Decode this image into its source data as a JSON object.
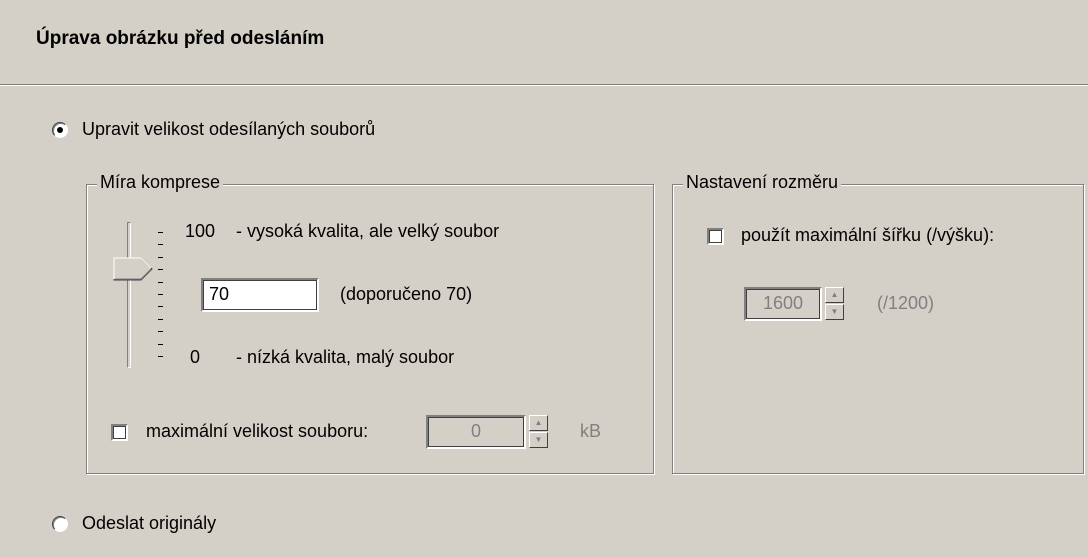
{
  "header": {
    "title": "Úprava obrázku před odesláním"
  },
  "options": {
    "resize_label": "Upravit velikost odesílaných souborů",
    "original_label": "Odeslat originály"
  },
  "compression": {
    "legend": "Míra komprese",
    "max_value": "100",
    "max_desc": "- vysoká kvalita, ale velký soubor",
    "current_value": "70",
    "recommended": "(doporučeno 70)",
    "min_value": "0",
    "min_desc": "- nízká kvalita, malý soubor",
    "slider_level": 70,
    "max_size_label": "maximální velikost souboru:",
    "max_size_value": "0",
    "max_size_unit": "kB"
  },
  "dimensions": {
    "legend": "Nastavení rozměru",
    "max_width_label": "použít maximální šířku  (/výšku):",
    "width_value": "1600",
    "height_hint": "(/1200)"
  },
  "state": {
    "resize_selected": true,
    "max_size_checked": false,
    "max_width_checked": false
  }
}
